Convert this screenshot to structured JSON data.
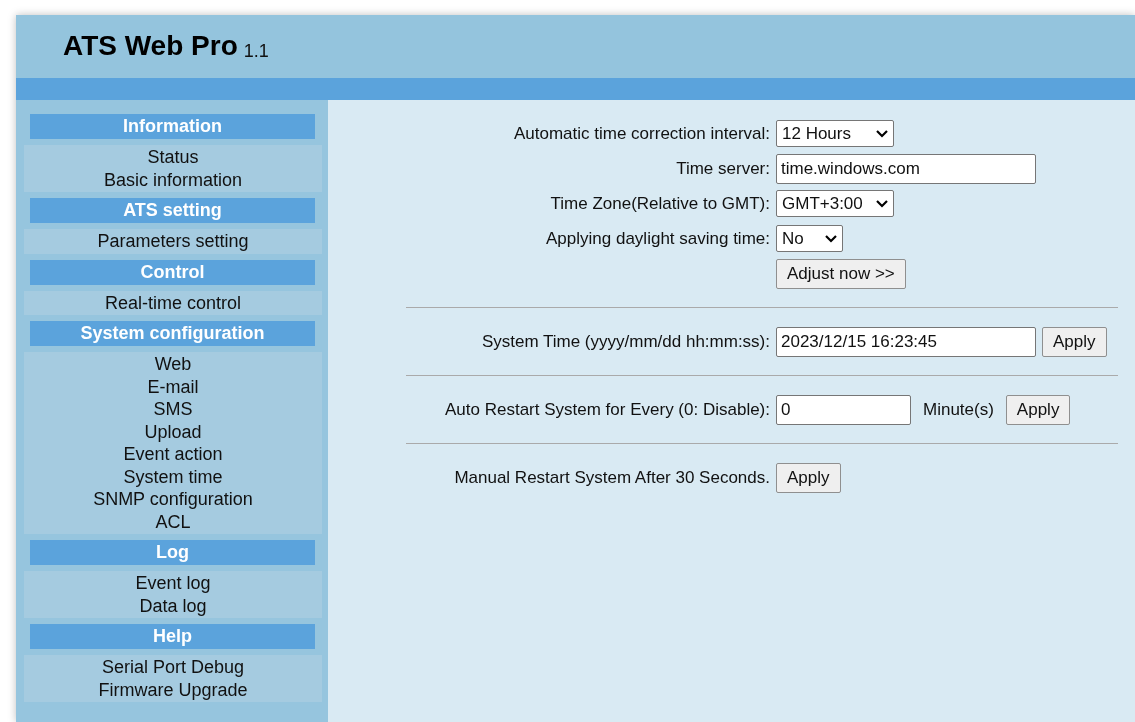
{
  "header": {
    "title": "ATS Web Pro",
    "version": "1.1"
  },
  "sidebar": {
    "sections": [
      {
        "title": "Information",
        "items": [
          "Status",
          "Basic information"
        ]
      },
      {
        "title": "ATS setting",
        "items": [
          "Parameters setting"
        ]
      },
      {
        "title": "Control",
        "items": [
          "Real-time control"
        ]
      },
      {
        "title": "System configuration",
        "items": [
          "Web",
          "E-mail",
          "SMS",
          "Upload",
          "Event action",
          "System time",
          "SNMP configuration",
          "ACL"
        ]
      },
      {
        "title": "Log",
        "items": [
          "Event log",
          "Data log"
        ]
      },
      {
        "title": "Help",
        "items": [
          "Serial Port Debug",
          "Firmware Upgrade"
        ]
      }
    ]
  },
  "groups": [
    [
      {
        "kind": "select",
        "label": "Automatic time correction interval:",
        "value": "12 Hours"
      },
      {
        "kind": "input",
        "label": "Time server:",
        "value": "time.windows.com"
      },
      {
        "kind": "select",
        "label": "Time Zone(Relative to GMT):",
        "value": "GMT+3:00"
      },
      {
        "kind": "select",
        "label": "Applying daylight saving time:",
        "value": "No"
      },
      {
        "kind": "button",
        "button": "Adjust now >>"
      }
    ],
    [
      {
        "kind": "input",
        "label": "System Time (yyyy/mm/dd hh:mm:ss):",
        "value": "2023/12/15 16:23:45",
        "button": "Apply"
      }
    ],
    [
      {
        "kind": "input",
        "label": "Auto Restart System for Every (0: Disable):",
        "value": "0",
        "unit": "Minute(s)",
        "button": "Apply"
      }
    ],
    [
      {
        "kind": "button",
        "label": "Manual Restart System After 30 Seconds.",
        "button": "Apply"
      }
    ]
  ]
}
